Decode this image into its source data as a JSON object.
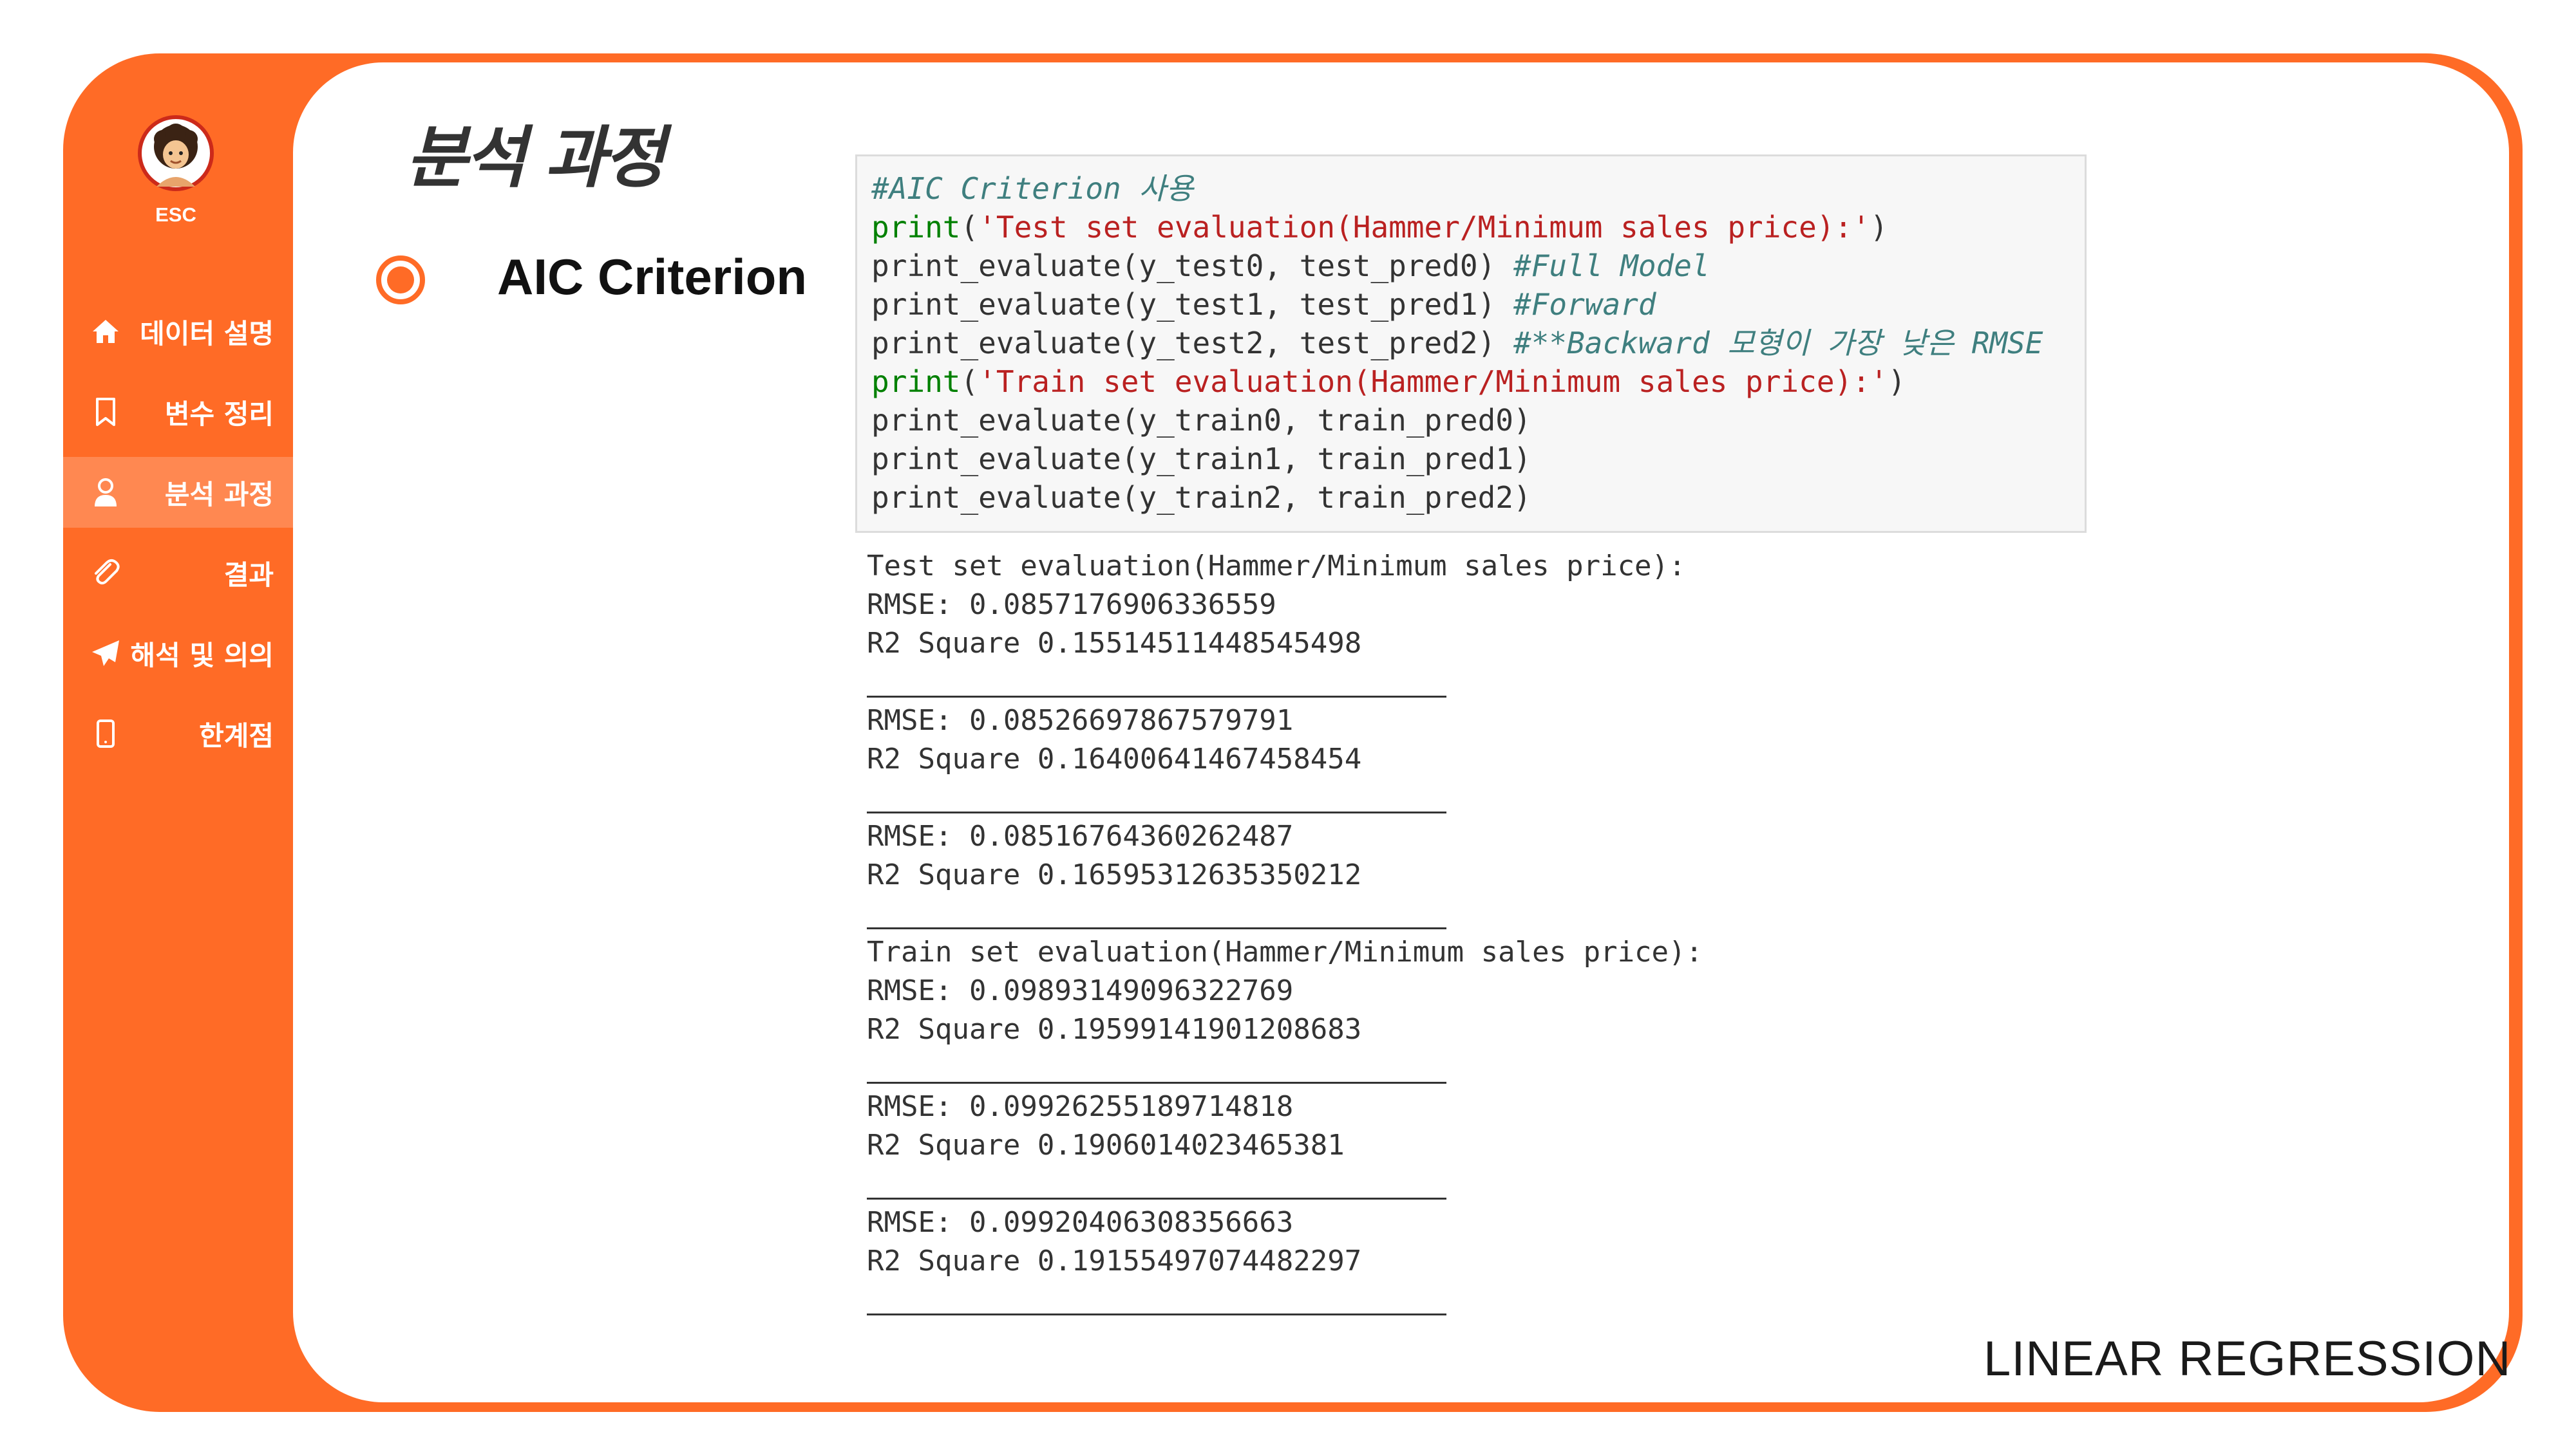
{
  "colors": {
    "accent": "#ff6b26",
    "panel": "#ffffff",
    "code_bg": "#f7f7f7",
    "comment": "#3f7f7f",
    "keyword": "#008000",
    "string": "#ba2121"
  },
  "sidebar": {
    "logo_text": "ESC",
    "items": [
      {
        "icon": "home-icon",
        "label": "데이터 설명"
      },
      {
        "icon": "bookmark-icon",
        "label": "변수 정리"
      },
      {
        "icon": "user-icon",
        "label": "분석 과정"
      },
      {
        "icon": "paperclip-icon",
        "label": "결과"
      },
      {
        "icon": "send-icon",
        "label": "해석 및 의의"
      },
      {
        "icon": "phone-icon",
        "label": "한계점"
      }
    ]
  },
  "header": {
    "page_title": "분석 과정",
    "section_title": "AIC Criterion"
  },
  "code": {
    "comment": "#AIC Criterion 사용",
    "line2_kw": "print",
    "line2_str": "'Test set evaluation(Hammer/Minimum sales price):'",
    "line3_code": "print_evaluate(y_test0, test_pred0) ",
    "line3_comment": "#Full Model",
    "line4_code": "print_evaluate(y_test1, test_pred1) ",
    "line4_comment": "#Forward",
    "line5_code": "print_evaluate(y_test2, test_pred2) ",
    "line5_comment": "#**Backward 모형이 가장 낮은 RMSE",
    "line6_kw": "print",
    "line6_str": "'Train set evaluation(Hammer/Minimum sales price):'",
    "line7": "print_evaluate(y_train0, train_pred0)",
    "line8": "print_evaluate(y_train1, train_pred1)",
    "line9": "print_evaluate(y_train2, train_pred2)"
  },
  "output": {
    "test_header": "Test set evaluation(Hammer/Minimum sales price):",
    "test_rmse_0": "RMSE: 0.0857176906336559",
    "test_r2_0": "R2 Square 0.15514511448545498",
    "test_rmse_1": "RMSE: 0.08526697867579791",
    "test_r2_1": "R2 Square 0.16400641467458454",
    "test_rmse_2": "RMSE: 0.08516764360262487",
    "test_r2_2": "R2 Square 0.16595312635350212",
    "train_header": "Train set evaluation(Hammer/Minimum sales price):",
    "train_rmse_0": "RMSE: 0.09893149096322769",
    "train_r2_0": "R2 Square 0.19599141901208683",
    "train_rmse_1": "RMSE: 0.09926255189714818",
    "train_r2_1": "R2 Square 0.1906014023465381",
    "train_rmse_2": "RMSE: 0.09920406308356663",
    "train_r2_2": "R2 Square 0.19155497074482297"
  },
  "footer": {
    "text": "LINEAR REGRESSION"
  }
}
